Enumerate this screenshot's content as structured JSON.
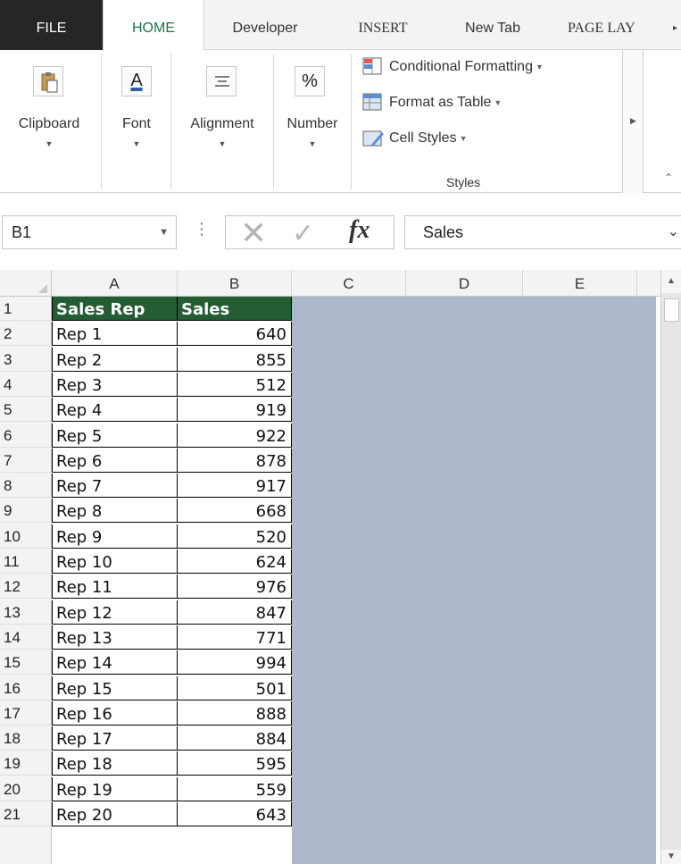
{
  "ribbon_tabs": [
    {
      "label": "FILE"
    },
    {
      "label": "HOME"
    },
    {
      "label": "Developer"
    },
    {
      "label": "INSERT"
    },
    {
      "label": "New Tab"
    },
    {
      "label": "PAGE LAY"
    }
  ],
  "active_tab": "HOME",
  "ribbon_groups": {
    "clipboard": "Clipboard",
    "font": "Font",
    "alignment": "Alignment",
    "number": "Number",
    "number_icon_glyph": "%",
    "font_icon_glyph": "A",
    "styles": {
      "conditional_formatting": "Conditional Formatting",
      "format_as_table": "Format as Table",
      "cell_styles": "Cell Styles",
      "group_label": "Styles"
    }
  },
  "formula_bar": {
    "name_box": "B1",
    "fx_symbol": "fx",
    "content": "Sales"
  },
  "columns": [
    "A",
    "B",
    "C",
    "D",
    "E"
  ],
  "rows": [
    {
      "n": "1",
      "a": "Sales Rep",
      "b": "Sales"
    },
    {
      "n": "2",
      "a": "Rep 1",
      "b": "640"
    },
    {
      "n": "3",
      "a": "Rep 2",
      "b": "855"
    },
    {
      "n": "4",
      "a": "Rep 3",
      "b": "512"
    },
    {
      "n": "5",
      "a": "Rep 4",
      "b": "919"
    },
    {
      "n": "6",
      "a": "Rep 5",
      "b": "922"
    },
    {
      "n": "7",
      "a": "Rep 6",
      "b": "878"
    },
    {
      "n": "8",
      "a": "Rep 7",
      "b": "917"
    },
    {
      "n": "9",
      "a": "Rep 8",
      "b": "668"
    },
    {
      "n": "10",
      "a": "Rep 9",
      "b": "520"
    },
    {
      "n": "11",
      "a": "Rep 10",
      "b": "624"
    },
    {
      "n": "12",
      "a": "Rep 11",
      "b": "976"
    },
    {
      "n": "13",
      "a": "Rep 12",
      "b": "847"
    },
    {
      "n": "14",
      "a": "Rep 13",
      "b": "771"
    },
    {
      "n": "15",
      "a": "Rep 14",
      "b": "994"
    },
    {
      "n": "16",
      "a": "Rep 15",
      "b": "501"
    },
    {
      "n": "17",
      "a": "Rep 16",
      "b": "888"
    },
    {
      "n": "18",
      "a": "Rep 17",
      "b": "884"
    },
    {
      "n": "19",
      "a": "Rep 18",
      "b": "595"
    },
    {
      "n": "20",
      "a": "Rep 19",
      "b": "559"
    },
    {
      "n": "21",
      "a": "Rep 20",
      "b": "643"
    }
  ],
  "colors": {
    "header_fill": "#245c33",
    "selection_shade": "#adb9ca",
    "active_tab_text": "#217346"
  }
}
